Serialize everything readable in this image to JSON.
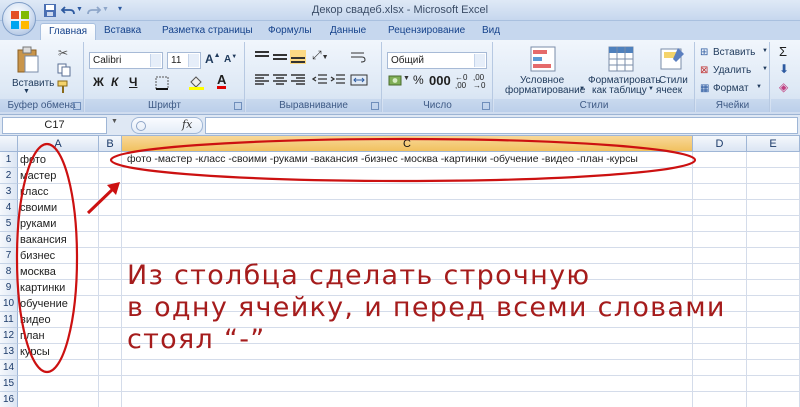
{
  "title": "Декор свадеб.xlsx - Microsoft Excel",
  "tabs": [
    "Главная",
    "Вставка",
    "Разметка страницы",
    "Формулы",
    "Данные",
    "Рецензирование",
    "Вид"
  ],
  "ribbon": {
    "clipboard": {
      "paste": "Вставить",
      "label": "Буфер обмена"
    },
    "font": {
      "name": "Calibri",
      "size": "11",
      "bold": "Ж",
      "italic": "К",
      "underline": "Ч",
      "label": "Шрифт"
    },
    "alignment": {
      "label": "Выравнивание"
    },
    "number": {
      "format": "Общий",
      "label": "Число"
    },
    "styles": {
      "conditional": [
        "Условное",
        "форматирование"
      ],
      "as_table": [
        "Форматировать",
        "как таблицу"
      ],
      "cell_styles": [
        "Стили",
        "ячеек"
      ],
      "label": "Стили"
    },
    "cells": {
      "insert": "Вставить",
      "delete": "Удалить",
      "format": "Формат",
      "label": "Ячейки"
    }
  },
  "formula_bar": {
    "name_box": "C17",
    "fx": "fx",
    "formula": ""
  },
  "columns": [
    "A",
    "B",
    "C",
    "D",
    "E"
  ],
  "rows": [
    "1",
    "2",
    "3",
    "4",
    "5",
    "6",
    "7",
    "8",
    "9",
    "10",
    "11",
    "12",
    "13",
    "14",
    "15",
    "16"
  ],
  "column_a": [
    "фото",
    "мастер",
    "класс",
    "своими",
    "руками",
    "вакансия",
    "бизнес",
    "москва",
    "картинки",
    "обучение",
    "видео",
    "план",
    "курсы"
  ],
  "c1": "фото -мастер -класс -своими -руками -вакансия -бизнес -москва -картинки -обучение -видео -план -курсы",
  "annotation": [
    "Из столбца сделать строчную",
    "в одну ячейку, и перед всеми словами",
    "стоял “-”"
  ],
  "colors": {
    "annotation": "#cc1111",
    "note_text": "#a51c1c"
  }
}
